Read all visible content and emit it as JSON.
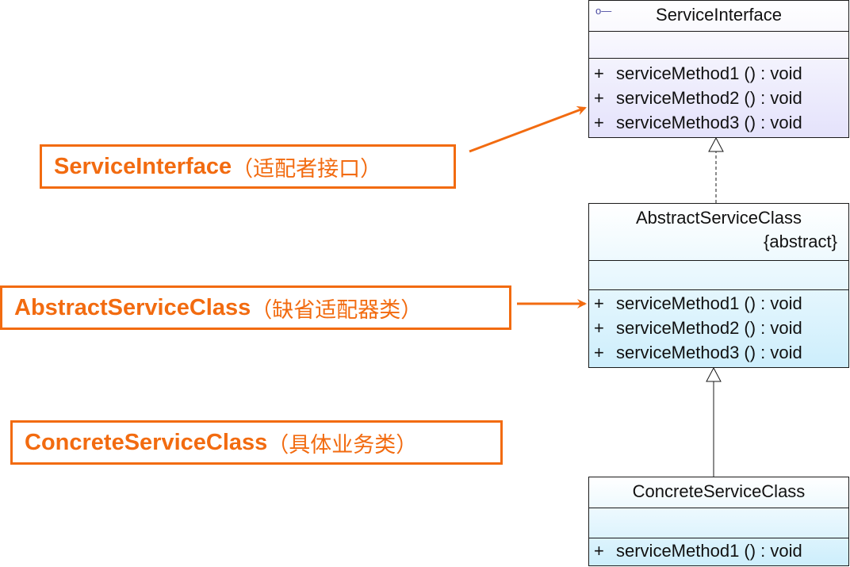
{
  "classes": {
    "service_interface": {
      "name": "ServiceInterface",
      "operations": [
        {
          "vis": "+",
          "sig": "serviceMethod1 () : void"
        },
        {
          "vis": "+",
          "sig": "serviceMethod2 () : void"
        },
        {
          "vis": "+",
          "sig": "serviceMethod3 () : void"
        }
      ]
    },
    "abstract_service_class": {
      "name": "AbstractServiceClass",
      "stereotype": "{abstract}",
      "operations": [
        {
          "vis": "+",
          "sig": "serviceMethod1 () : void"
        },
        {
          "vis": "+",
          "sig": "serviceMethod2 () : void"
        },
        {
          "vis": "+",
          "sig": "serviceMethod3 () : void"
        }
      ]
    },
    "concrete_service_class": {
      "name": "ConcreteServiceClass",
      "operations": [
        {
          "vis": "+",
          "sig": "serviceMethod1 () : void"
        }
      ]
    }
  },
  "labels": {
    "service_interface": {
      "en": "ServiceInterface",
      "cn": "（适配者接口）"
    },
    "abstract_service_class": {
      "en": "AbstractServiceClass",
      "cn": "（缺省适配器类）"
    },
    "concrete_service_class": {
      "en": "ConcreteServiceClass",
      "cn": "（具体业务类）"
    }
  },
  "colors": {
    "accent": "#f26b10",
    "interface_fill": "#e4e2fb",
    "class_fill": "#cdeefc",
    "border": "#1a1a1a"
  },
  "icons": {
    "interface_marker": "interface-lollipop-icon"
  }
}
